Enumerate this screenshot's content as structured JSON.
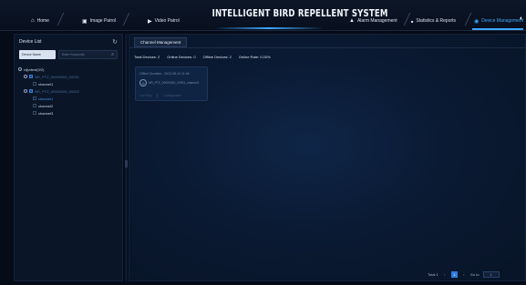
{
  "nav": {
    "items": [
      {
        "label": "Home",
        "icon": "home-icon",
        "glyph": "⌂"
      },
      {
        "label": "Image Patrol",
        "icon": "image-icon",
        "glyph": "▣"
      },
      {
        "label": "Video Patrol",
        "icon": "video-icon",
        "glyph": "▶"
      },
      {
        "label": "Alarm Management",
        "icon": "alarm-icon",
        "glyph": "▲"
      },
      {
        "label": "Statistics & Reports",
        "icon": "chart-icon",
        "glyph": "■"
      },
      {
        "label": "Device Management",
        "icon": "device-icon",
        "glyph": "◉"
      }
    ],
    "title": "INTELLIGENT BIRD REPELLENT SYSTEM",
    "active_color": "#3da7ff"
  },
  "device_list": {
    "title": "Device List",
    "select_value": "Device Name",
    "search_placeholder": "Enter Keywords",
    "tree": {
      "root": "rdjvdent(0/2)",
      "devices": [
        {
          "name": "NR_PTZ_00000000_00001"
        },
        {
          "name": "NR_PTZ_00000000_00002"
        }
      ],
      "channels": [
        "channel1",
        "channel1",
        "channel2",
        "channel3"
      ]
    }
  },
  "main": {
    "tab": "Channel Management",
    "stats": {
      "total": "Total Devices:  2",
      "online": "Online Devices:  0",
      "offline": "Offline Devices:  2",
      "rate": "Online Rate:  0.00%"
    },
    "card": {
      "header": "Offline Duration : 2023-08-10 11:46",
      "name": "NR_PTZ_00000000_00001_channel1",
      "action1": "Live Play",
      "action2": "Configuration"
    },
    "pager": {
      "total": "Total 1",
      "page": "1",
      "goto": "Go to",
      "goto_value": "1"
    }
  }
}
